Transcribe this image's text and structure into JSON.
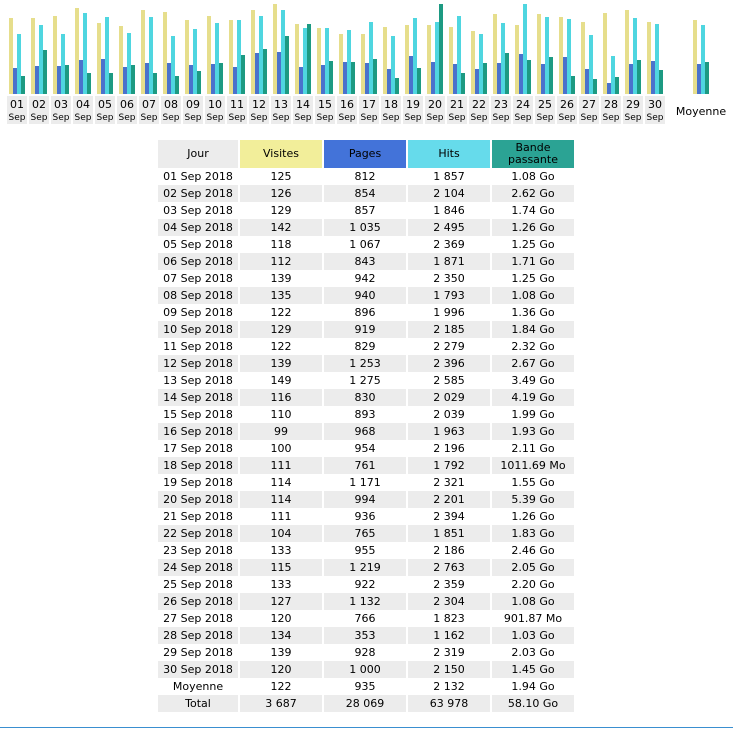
{
  "colors": {
    "visits": "#e6de8c",
    "pages": "#4a72cc",
    "hits": "#4fd6e0",
    "bandwidth": "#1d9a82",
    "header_jour": "#ececec",
    "header_visits": "#f2ee9a",
    "header_pages": "#4373d9",
    "header_hits": "#66dbeb",
    "header_bandwidth": "#2ba394",
    "label_box": "#ececec"
  },
  "chart_data": {
    "type": "bar",
    "categories": [
      [
        "01",
        "Sep"
      ],
      [
        "02",
        "Sep"
      ],
      [
        "03",
        "Sep"
      ],
      [
        "04",
        "Sep"
      ],
      [
        "05",
        "Sep"
      ],
      [
        "06",
        "Sep"
      ],
      [
        "07",
        "Sep"
      ],
      [
        "08",
        "Sep"
      ],
      [
        "09",
        "Sep"
      ],
      [
        "10",
        "Sep"
      ],
      [
        "11",
        "Sep"
      ],
      [
        "12",
        "Sep"
      ],
      [
        "13",
        "Sep"
      ],
      [
        "14",
        "Sep"
      ],
      [
        "15",
        "Sep"
      ],
      [
        "16",
        "Sep"
      ],
      [
        "17",
        "Sep"
      ],
      [
        "18",
        "Sep"
      ],
      [
        "19",
        "Sep"
      ],
      [
        "20",
        "Sep"
      ],
      [
        "21",
        "Sep"
      ],
      [
        "22",
        "Sep"
      ],
      [
        "23",
        "Sep"
      ],
      [
        "24",
        "Sep"
      ],
      [
        "25",
        "Sep"
      ],
      [
        "26",
        "Sep"
      ],
      [
        "27",
        "Sep"
      ],
      [
        "28",
        "Sep"
      ],
      [
        "29",
        "Sep"
      ],
      [
        "30",
        "Sep"
      ]
    ],
    "average_label": "Moyenne",
    "series": [
      {
        "key": "visits",
        "color": "#e6de8c",
        "values": [
          125,
          126,
          129,
          142,
          118,
          112,
          139,
          135,
          122,
          129,
          122,
          139,
          149,
          116,
          110,
          99,
          100,
          111,
          114,
          114,
          111,
          104,
          133,
          115,
          133,
          127,
          120,
          134,
          139,
          120
        ],
        "average": 122,
        "max": 149
      },
      {
        "key": "pages",
        "color": "#4a72cc",
        "values": [
          812,
          854,
          857,
          1035,
          1067,
          843,
          942,
          940,
          896,
          919,
          829,
          1253,
          1275,
          830,
          893,
          968,
          954,
          761,
          1171,
          994,
          936,
          765,
          955,
          1219,
          922,
          1132,
          766,
          353,
          928,
          1000
        ],
        "average": 935,
        "max": 2763
      },
      {
        "key": "hits",
        "color": "#4fd6e0",
        "values": [
          1857,
          2104,
          1846,
          2495,
          2369,
          1871,
          2350,
          1793,
          1996,
          2185,
          2279,
          2396,
          2585,
          2029,
          2039,
          1963,
          2196,
          1792,
          2321,
          2201,
          2394,
          1851,
          2186,
          2763,
          2359,
          2304,
          1823,
          1162,
          2319,
          2150
        ],
        "average": 2132,
        "max": 2763
      },
      {
        "key": "bandwidth",
        "color": "#1d9a82",
        "unit": "Go",
        "values": [
          1.08,
          2.62,
          1.74,
          1.26,
          1.25,
          1.71,
          1.25,
          1.08,
          1.36,
          1.84,
          2.32,
          2.67,
          3.49,
          4.19,
          1.99,
          1.93,
          2.11,
          0.988,
          1.55,
          5.39,
          1.26,
          1.83,
          2.46,
          2.05,
          2.2,
          1.08,
          0.881,
          1.03,
          2.03,
          1.45
        ],
        "average": 1.94,
        "max": 5.39
      }
    ]
  },
  "table": {
    "headers": {
      "day": "Jour",
      "visits": "Visites",
      "pages": "Pages",
      "hits": "Hits",
      "bandwidth_line1": "Bande",
      "bandwidth_line2": "passante"
    },
    "rows": [
      {
        "day": "01 Sep 2018",
        "visits": "125",
        "pages": "812",
        "hits": "1 857",
        "bandwidth": "1.08 Go"
      },
      {
        "day": "02 Sep 2018",
        "visits": "126",
        "pages": "854",
        "hits": "2 104",
        "bandwidth": "2.62 Go"
      },
      {
        "day": "03 Sep 2018",
        "visits": "129",
        "pages": "857",
        "hits": "1 846",
        "bandwidth": "1.74 Go"
      },
      {
        "day": "04 Sep 2018",
        "visits": "142",
        "pages": "1 035",
        "hits": "2 495",
        "bandwidth": "1.26 Go"
      },
      {
        "day": "05 Sep 2018",
        "visits": "118",
        "pages": "1 067",
        "hits": "2 369",
        "bandwidth": "1.25 Go"
      },
      {
        "day": "06 Sep 2018",
        "visits": "112",
        "pages": "843",
        "hits": "1 871",
        "bandwidth": "1.71 Go"
      },
      {
        "day": "07 Sep 2018",
        "visits": "139",
        "pages": "942",
        "hits": "2 350",
        "bandwidth": "1.25 Go"
      },
      {
        "day": "08 Sep 2018",
        "visits": "135",
        "pages": "940",
        "hits": "1 793",
        "bandwidth": "1.08 Go"
      },
      {
        "day": "09 Sep 2018",
        "visits": "122",
        "pages": "896",
        "hits": "1 996",
        "bandwidth": "1.36 Go"
      },
      {
        "day": "10 Sep 2018",
        "visits": "129",
        "pages": "919",
        "hits": "2 185",
        "bandwidth": "1.84 Go"
      },
      {
        "day": "11 Sep 2018",
        "visits": "122",
        "pages": "829",
        "hits": "2 279",
        "bandwidth": "2.32 Go"
      },
      {
        "day": "12 Sep 2018",
        "visits": "139",
        "pages": "1 253",
        "hits": "2 396",
        "bandwidth": "2.67 Go"
      },
      {
        "day": "13 Sep 2018",
        "visits": "149",
        "pages": "1 275",
        "hits": "2 585",
        "bandwidth": "3.49 Go"
      },
      {
        "day": "14 Sep 2018",
        "visits": "116",
        "pages": "830",
        "hits": "2 029",
        "bandwidth": "4.19 Go"
      },
      {
        "day": "15 Sep 2018",
        "visits": "110",
        "pages": "893",
        "hits": "2 039",
        "bandwidth": "1.99 Go"
      },
      {
        "day": "16 Sep 2018",
        "visits": "99",
        "pages": "968",
        "hits": "1 963",
        "bandwidth": "1.93 Go"
      },
      {
        "day": "17 Sep 2018",
        "visits": "100",
        "pages": "954",
        "hits": "2 196",
        "bandwidth": "2.11 Go"
      },
      {
        "day": "18 Sep 2018",
        "visits": "111",
        "pages": "761",
        "hits": "1 792",
        "bandwidth": "1011.69 Mo"
      },
      {
        "day": "19 Sep 2018",
        "visits": "114",
        "pages": "1 171",
        "hits": "2 321",
        "bandwidth": "1.55 Go"
      },
      {
        "day": "20 Sep 2018",
        "visits": "114",
        "pages": "994",
        "hits": "2 201",
        "bandwidth": "5.39 Go"
      },
      {
        "day": "21 Sep 2018",
        "visits": "111",
        "pages": "936",
        "hits": "2 394",
        "bandwidth": "1.26 Go"
      },
      {
        "day": "22 Sep 2018",
        "visits": "104",
        "pages": "765",
        "hits": "1 851",
        "bandwidth": "1.83 Go"
      },
      {
        "day": "23 Sep 2018",
        "visits": "133",
        "pages": "955",
        "hits": "2 186",
        "bandwidth": "2.46 Go"
      },
      {
        "day": "24 Sep 2018",
        "visits": "115",
        "pages": "1 219",
        "hits": "2 763",
        "bandwidth": "2.05 Go"
      },
      {
        "day": "25 Sep 2018",
        "visits": "133",
        "pages": "922",
        "hits": "2 359",
        "bandwidth": "2.20 Go"
      },
      {
        "day": "26 Sep 2018",
        "visits": "127",
        "pages": "1 132",
        "hits": "2 304",
        "bandwidth": "1.08 Go"
      },
      {
        "day": "27 Sep 2018",
        "visits": "120",
        "pages": "766",
        "hits": "1 823",
        "bandwidth": "901.87 Mo"
      },
      {
        "day": "28 Sep 2018",
        "visits": "134",
        "pages": "353",
        "hits": "1 162",
        "bandwidth": "1.03 Go"
      },
      {
        "day": "29 Sep 2018",
        "visits": "139",
        "pages": "928",
        "hits": "2 319",
        "bandwidth": "2.03 Go"
      },
      {
        "day": "30 Sep 2018",
        "visits": "120",
        "pages": "1 000",
        "hits": "2 150",
        "bandwidth": "1.45 Go"
      }
    ],
    "average": {
      "day": "Moyenne",
      "visits": "122",
      "pages": "935",
      "hits": "2 132",
      "bandwidth": "1.94 Go"
    },
    "total": {
      "day": "Total",
      "visits": "3 687",
      "pages": "28 069",
      "hits": "63 978",
      "bandwidth": "58.10 Go"
    }
  }
}
